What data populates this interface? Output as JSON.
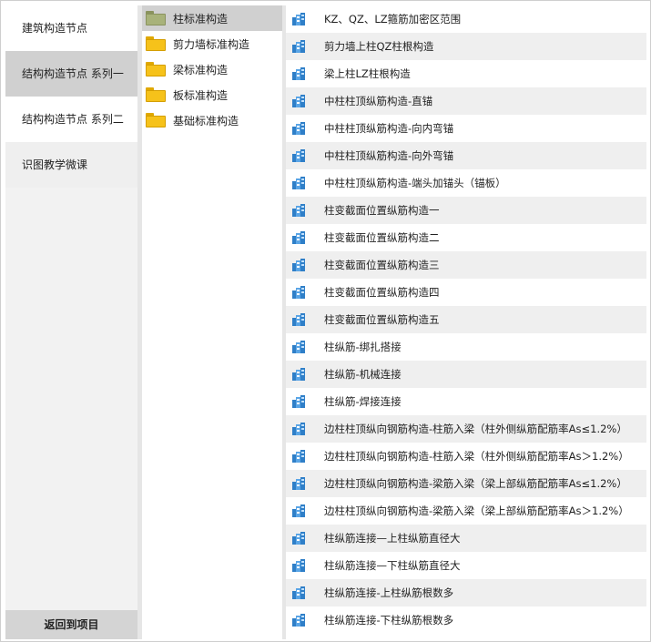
{
  "categories": [
    {
      "label": "建筑构造节点",
      "state": "plain"
    },
    {
      "label": "结构构造节点 系列一",
      "state": "sel"
    },
    {
      "label": "结构构造节点 系列二",
      "state": "plain"
    },
    {
      "label": "识图教学微课",
      "state": "grey"
    }
  ],
  "return_label": "返回到项目",
  "folders": [
    {
      "label": "柱标准构造",
      "selected": true,
      "icon": "folder-open-icon"
    },
    {
      "label": "剪力墙标准构造",
      "selected": false,
      "icon": "folder-icon"
    },
    {
      "label": "梁标准构造",
      "selected": false,
      "icon": "folder-icon"
    },
    {
      "label": "板标准构造",
      "selected": false,
      "icon": "folder-icon"
    },
    {
      "label": "基础标准构造",
      "selected": false,
      "icon": "folder-icon"
    }
  ],
  "items": [
    "KZ、QZ、LZ箍筋加密区范围",
    "剪力墙上柱QZ柱根构造",
    "梁上柱LZ柱根构造",
    "中柱柱顶纵筋构造-直锚",
    "中柱柱顶纵筋构造-向内弯锚",
    "中柱柱顶纵筋构造-向外弯锚",
    "中柱柱顶纵筋构造-端头加锚头（锚板）",
    "柱变截面位置纵筋构造一",
    "柱变截面位置纵筋构造二",
    "柱变截面位置纵筋构造三",
    "柱变截面位置纵筋构造四",
    "柱变截面位置纵筋构造五",
    "柱纵筋-绑扎搭接",
    "柱纵筋-机械连接",
    "柱纵筋-焊接连接",
    "边柱柱顶纵向钢筋构造-柱筋入梁（柱外侧纵筋配筋率As≤1.2%）",
    "边柱柱顶纵向钢筋构造-柱筋入梁（柱外侧纵筋配筋率As＞1.2%）",
    "边柱柱顶纵向钢筋构造-梁筋入梁（梁上部纵筋配筋率As≤1.2%）",
    "边柱柱顶纵向钢筋构造-梁筋入梁（梁上部纵筋配筋率As＞1.2%）",
    "柱纵筋连接—上柱纵筋直径大",
    "柱纵筋连接—下柱纵筋直径大",
    "柱纵筋连接-上柱纵筋根数多",
    "柱纵筋连接-下柱纵筋根数多"
  ],
  "item_icon": "3d-model-icon",
  "colors": {
    "selected_bg": "#d0d0d0",
    "stripe_bg": "#efefef",
    "icon_blue": "#3a8fd6"
  }
}
